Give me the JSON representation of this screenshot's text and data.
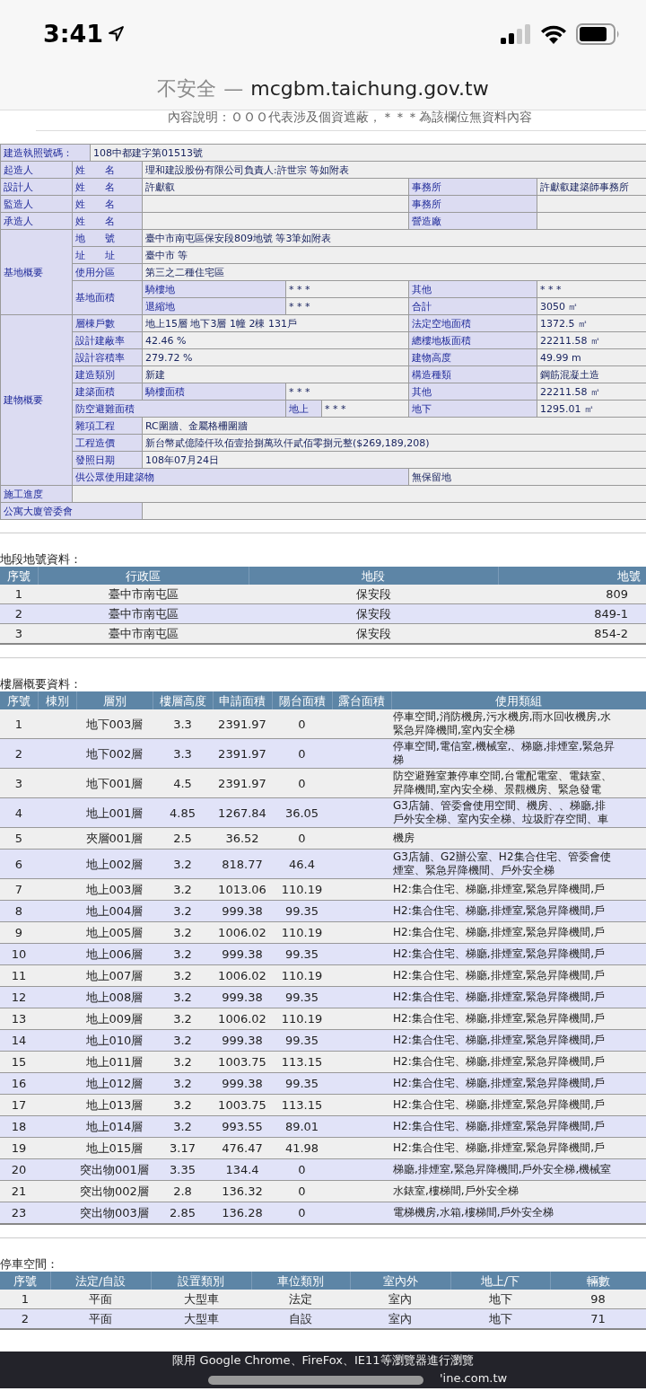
{
  "status_bar": {
    "time": "3:41"
  },
  "address_bar": {
    "security": "不安全",
    "separator": "—",
    "domain": "mcgbm.taichung.gov.tw"
  },
  "notice": "內容說明：ＯＯＯ代表涉及個資遮蔽，＊＊＊為該欄位無資料內容",
  "permit_table": {
    "rows": [
      {
        "cells": [
          {
            "kind": "label",
            "text": "建造執照號碼：",
            "colspan": 2
          },
          {
            "kind": "value",
            "text": "108中都建字第01513號",
            "colspan": 6
          }
        ]
      },
      {
        "cells": [
          {
            "kind": "label",
            "text": "起造人"
          },
          {
            "kind": "label",
            "text": "姓　　名",
            "colspan": 2
          },
          {
            "kind": "value",
            "text": "理和建設股份有限公司負責人:許世宗 等如附表",
            "colspan": 5
          }
        ]
      },
      {
        "cells": [
          {
            "kind": "label",
            "text": "設計人"
          },
          {
            "kind": "label",
            "text": "姓　　名",
            "colspan": 2
          },
          {
            "kind": "value",
            "text": "許獻叡",
            "colspan": 3
          },
          {
            "kind": "label",
            "text": "事務所"
          },
          {
            "kind": "value",
            "text": "許獻叡建築師事務所"
          }
        ]
      },
      {
        "cells": [
          {
            "kind": "label",
            "text": "監造人"
          },
          {
            "kind": "label",
            "text": "姓　　名",
            "colspan": 2
          },
          {
            "kind": "value",
            "colspan": 3
          },
          {
            "kind": "label",
            "text": "事務所"
          },
          {
            "kind": "value"
          }
        ]
      },
      {
        "cells": [
          {
            "kind": "label",
            "text": "承造人"
          },
          {
            "kind": "label",
            "text": "姓　　名",
            "colspan": 2
          },
          {
            "kind": "value",
            "colspan": 3
          },
          {
            "kind": "label",
            "text": "營造廠"
          },
          {
            "kind": "value"
          }
        ]
      },
      {
        "cells": [
          {
            "kind": "label",
            "text": "基地概要",
            "rowspan": 5
          },
          {
            "kind": "label",
            "text": "地　　號",
            "colspan": 2
          },
          {
            "kind": "value",
            "text": "臺中市南屯區保安段809地號 等3筆如附表",
            "colspan": 5
          }
        ]
      },
      {
        "cells": [
          {
            "kind": "label",
            "text": "址　　址",
            "colspan": 2
          },
          {
            "kind": "value",
            "text": "臺中市 等",
            "colspan": 5
          }
        ]
      },
      {
        "cells": [
          {
            "kind": "label",
            "text": "使用分區",
            "colspan": 2
          },
          {
            "kind": "value",
            "text": "第三之二種住宅區",
            "colspan": 5
          }
        ]
      },
      {
        "cells": [
          {
            "kind": "label",
            "text": "基地面積",
            "colspan": 2,
            "rowspan": 2
          },
          {
            "kind": "label",
            "text": "騎樓地"
          },
          {
            "kind": "value",
            "text": "* * *",
            "colspan": 2
          },
          {
            "kind": "label",
            "text": "其他"
          },
          {
            "kind": "value",
            "text": "* * *"
          }
        ]
      },
      {
        "cells": [
          {
            "kind": "label",
            "text": "退縮地"
          },
          {
            "kind": "value",
            "text": "* * *",
            "colspan": 2
          },
          {
            "kind": "label",
            "text": "合計"
          },
          {
            "kind": "value",
            "text": "3050 ㎡"
          }
        ]
      },
      {
        "cells": [
          {
            "kind": "label",
            "text": "建物概要",
            "rowspan": 10
          },
          {
            "kind": "label",
            "text": "層棟戶數",
            "colspan": 2
          },
          {
            "kind": "value",
            "text": "地上15層 地下3層 1幢 2棟 131戶",
            "colspan": 3
          },
          {
            "kind": "label",
            "text": "法定空地面積"
          },
          {
            "kind": "value",
            "text": "1372.5 ㎡"
          }
        ]
      },
      {
        "cells": [
          {
            "kind": "label",
            "text": "設計建蔽率",
            "colspan": 2
          },
          {
            "kind": "value",
            "text": "42.46 %",
            "colspan": 3
          },
          {
            "kind": "label",
            "text": "總樓地板面積"
          },
          {
            "kind": "value",
            "text": "22211.58 ㎡"
          }
        ]
      },
      {
        "cells": [
          {
            "kind": "label",
            "text": "設計容積率",
            "colspan": 2
          },
          {
            "kind": "value",
            "text": "279.72 %",
            "colspan": 3
          },
          {
            "kind": "label",
            "text": "建物高度"
          },
          {
            "kind": "value",
            "text": "49.99 m"
          }
        ]
      },
      {
        "cells": [
          {
            "kind": "label",
            "text": "建造類別",
            "colspan": 2
          },
          {
            "kind": "value",
            "text": "新建",
            "colspan": 3
          },
          {
            "kind": "label",
            "text": "構造種類"
          },
          {
            "kind": "value",
            "text": "鋼筋混凝土造"
          }
        ]
      },
      {
        "cells": [
          {
            "kind": "label",
            "text": "建築面積",
            "colspan": 2
          },
          {
            "kind": "label",
            "text": "騎樓面積"
          },
          {
            "kind": "value",
            "text": "* * *",
            "colspan": 2
          },
          {
            "kind": "label",
            "text": "其他"
          },
          {
            "kind": "value",
            "text": "22211.58 ㎡"
          }
        ]
      },
      {
        "cells": [
          {
            "kind": "label",
            "text": "防空避難面積",
            "colspan": 3
          },
          {
            "kind": "label",
            "text": "地上"
          },
          {
            "kind": "value",
            "text": "* * *"
          },
          {
            "kind": "label",
            "text": "地下"
          },
          {
            "kind": "value",
            "text": "1295.01 ㎡"
          }
        ]
      },
      {
        "cells": [
          {
            "kind": "label",
            "text": "雜項工程",
            "colspan": 2
          },
          {
            "kind": "value",
            "text": "RC圍牆、金屬格柵圍牆",
            "colspan": 5
          }
        ]
      },
      {
        "cells": [
          {
            "kind": "label",
            "text": "工程造價",
            "colspan": 2
          },
          {
            "kind": "value",
            "text": "新台幣貳億陸仟玖佰壹拾捌萬玖仟貳佰零捌元整($269,189,208)",
            "colspan": 5
          }
        ]
      },
      {
        "cells": [
          {
            "kind": "label",
            "text": "發照日期",
            "colspan": 2
          },
          {
            "kind": "value",
            "text": "108年07月24日",
            "colspan": 5
          }
        ]
      },
      {
        "cells": [
          {
            "kind": "label",
            "text": "供公眾使用建築物",
            "colspan": 5
          },
          {
            "kind": "value",
            "text": "無保留地",
            "colspan": 2
          }
        ]
      },
      {
        "cells": [
          {
            "kind": "label",
            "text": "施工進度"
          },
          {
            "kind": "value",
            "colspan": 7
          }
        ]
      },
      {
        "cells": [
          {
            "kind": "label",
            "text": "公寓大廈管委會",
            "colspan": 3
          },
          {
            "kind": "value",
            "colspan": 5
          }
        ]
      }
    ]
  },
  "land_section": {
    "title": "地段地號資料：",
    "columns": [
      "序號",
      "行政區",
      "地段",
      "地號"
    ],
    "rows": [
      [
        "1",
        "臺中市南屯區",
        "保安段",
        "809"
      ],
      [
        "2",
        "臺中市南屯區",
        "保安段",
        "849-1"
      ],
      [
        "3",
        "臺中市南屯區",
        "保安段",
        "854-2"
      ]
    ]
  },
  "floor_section": {
    "title": "樓層概要資料：",
    "columns": [
      "序號",
      "棟別",
      "層別",
      "樓層高度",
      "申請面積",
      "陽台面積",
      "露台面積",
      "使用類組"
    ],
    "rows": [
      {
        "cells": [
          "1",
          "",
          "地下003層",
          "3.3",
          "2391.97",
          "0",
          ""
        ],
        "use": [
          "停車空間,消防機房,污水機房,雨水回收機房,水",
          "緊急昇降機間,室內安全梯"
        ]
      },
      {
        "cells": [
          "2",
          "",
          "地下002層",
          "3.3",
          "2391.97",
          "0",
          ""
        ],
        "use": [
          "停車空間,電信室,機械室,、梯廳,排煙室,緊急昇",
          "梯"
        ]
      },
      {
        "cells": [
          "3",
          "",
          "地下001層",
          "4.5",
          "2391.97",
          "0",
          ""
        ],
        "use": [
          "防空避難室兼停車空間,台電配電室、電錶室、",
          "昇降機間,室內安全梯、景觀機房、緊急發電"
        ]
      },
      {
        "cells": [
          "4",
          "",
          "地上001層",
          "4.85",
          "1267.84",
          "36.05",
          ""
        ],
        "use": [
          "G3店舖、管委會使用空間、機房、、梯廳,排",
          "戶外安全梯、室內安全梯、垃圾貯存空間、車"
        ]
      },
      {
        "cells": [
          "5",
          "",
          "夾層001層",
          "2.5",
          "36.52",
          "0",
          ""
        ],
        "use": [
          "機房"
        ]
      },
      {
        "cells": [
          "6",
          "",
          "地上002層",
          "3.2",
          "818.77",
          "46.4",
          ""
        ],
        "use": [
          "G3店舖、G2辦公室、H2集合住宅、管委會使",
          "煙室、緊急昇降機間、戶外安全梯"
        ]
      },
      {
        "cells": [
          "7",
          "",
          "地上003層",
          "3.2",
          "1013.06",
          "110.19",
          ""
        ],
        "use": [
          "H2:集合住宅、梯廳,排煙室,緊急昇降機間,戶"
        ]
      },
      {
        "cells": [
          "8",
          "",
          "地上004層",
          "3.2",
          "999.38",
          "99.35",
          ""
        ],
        "use": [
          "H2:集合住宅、梯廳,排煙室,緊急昇降機間,戶"
        ]
      },
      {
        "cells": [
          "9",
          "",
          "地上005層",
          "3.2",
          "1006.02",
          "110.19",
          ""
        ],
        "use": [
          "H2:集合住宅、梯廳,排煙室,緊急昇降機間,戶"
        ]
      },
      {
        "cells": [
          "10",
          "",
          "地上006層",
          "3.2",
          "999.38",
          "99.35",
          ""
        ],
        "use": [
          "H2:集合住宅、梯廳,排煙室,緊急昇降機間,戶"
        ]
      },
      {
        "cells": [
          "11",
          "",
          "地上007層",
          "3.2",
          "1006.02",
          "110.19",
          ""
        ],
        "use": [
          "H2:集合住宅、梯廳,排煙室,緊急昇降機間,戶"
        ]
      },
      {
        "cells": [
          "12",
          "",
          "地上008層",
          "3.2",
          "999.38",
          "99.35",
          ""
        ],
        "use": [
          "H2:集合住宅、梯廳,排煙室,緊急昇降機間,戶"
        ]
      },
      {
        "cells": [
          "13",
          "",
          "地上009層",
          "3.2",
          "1006.02",
          "110.19",
          ""
        ],
        "use": [
          "H2:集合住宅、梯廳,排煙室,緊急昇降機間,戶"
        ]
      },
      {
        "cells": [
          "14",
          "",
          "地上010層",
          "3.2",
          "999.38",
          "99.35",
          ""
        ],
        "use": [
          "H2:集合住宅、梯廳,排煙室,緊急昇降機間,戶"
        ]
      },
      {
        "cells": [
          "15",
          "",
          "地上011層",
          "3.2",
          "1003.75",
          "113.15",
          ""
        ],
        "use": [
          "H2:集合住宅、梯廳,排煙室,緊急昇降機間,戶"
        ]
      },
      {
        "cells": [
          "16",
          "",
          "地上012層",
          "3.2",
          "999.38",
          "99.35",
          ""
        ],
        "use": [
          "H2:集合住宅、梯廳,排煙室,緊急昇降機間,戶"
        ]
      },
      {
        "cells": [
          "17",
          "",
          "地上013層",
          "3.2",
          "1003.75",
          "113.15",
          ""
        ],
        "use": [
          "H2:集合住宅、梯廳,排煙室,緊急昇降機間,戶"
        ]
      },
      {
        "cells": [
          "18",
          "",
          "地上014層",
          "3.2",
          "993.55",
          "89.01",
          ""
        ],
        "use": [
          "H2:集合住宅、梯廳,排煙室,緊急昇降機間,戶"
        ]
      },
      {
        "cells": [
          "19",
          "",
          "地上015層",
          "3.17",
          "476.47",
          "41.98",
          ""
        ],
        "use": [
          "H2:集合住宅、梯廳,排煙室,緊急昇降機間,戶"
        ]
      },
      {
        "cells": [
          "20",
          "",
          "突出物001層",
          "3.35",
          "134.4",
          "0",
          ""
        ],
        "use": [
          "梯廳,排煙室,緊急昇降機間,戶外安全梯,機械室"
        ]
      },
      {
        "cells": [
          "21",
          "",
          "突出物002層",
          "2.8",
          "136.32",
          "0",
          ""
        ],
        "use": [
          "水錶室,樓梯間,戶外安全梯"
        ]
      },
      {
        "cells": [
          "23",
          "",
          "突出物003層",
          "2.85",
          "136.28",
          "0",
          ""
        ],
        "use": [
          "電梯機房,水箱,樓梯間,戶外安全梯"
        ]
      }
    ]
  },
  "parking_section": {
    "title": "停車空間：",
    "columns": [
      "序號",
      "法定/自設",
      "設置類別",
      "車位類別",
      "室內外",
      "地上/下",
      "輛數"
    ],
    "rows": [
      [
        "1",
        "平面",
        "大型車",
        "法定",
        "室內",
        "地下",
        "98"
      ],
      [
        "2",
        "平面",
        "大型車",
        "自設",
        "室內",
        "地下",
        "71"
      ]
    ]
  },
  "footer": {
    "lines": [
      "限用 Google Chrome、FireFox、IE11等瀏覽器進行瀏覽",
      "'ine.com.tw"
    ]
  }
}
